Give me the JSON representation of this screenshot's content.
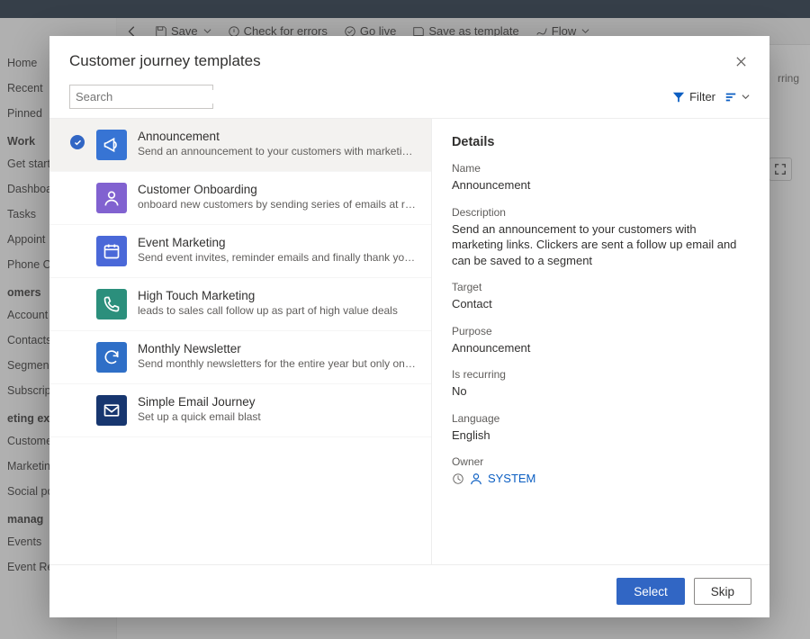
{
  "bg": {
    "toolbar": {
      "save": "Save",
      "check": "Check for errors",
      "golive": "Go live",
      "saveas": "Save as template",
      "flow": "Flow"
    },
    "leftnav": {
      "home": "Home",
      "recent": "Recent",
      "pinned": "Pinned",
      "section_work": "Work",
      "getstart": "Get start",
      "dashboard": "Dashboa",
      "tasks": "Tasks",
      "appoint": "Appoint",
      "phonec": "Phone C",
      "section_customers": "omers",
      "account": "Account",
      "contacts": "Contacts",
      "segments": "Segmen",
      "subscri": "Subscrip",
      "section_mktexec": "eting ex",
      "custjour": "Custome",
      "mktemail": "Marketin",
      "socialpo": "Social po",
      "section_eventmgmt": " manag",
      "events": "Events",
      "eventreg": "Event Registrations"
    },
    "summary_label": "rring"
  },
  "modal": {
    "title": "Customer journey templates",
    "search_placeholder": "Search",
    "filter_label": "Filter",
    "details_heading": "Details",
    "select_btn": "Select",
    "skip_btn": "Skip"
  },
  "templates": [
    {
      "title": "Announcement",
      "desc": "Send an announcement to your customers with marketing links. Clickers are sent a...",
      "tile_color": "#3774d4",
      "icon": "megaphone",
      "selected": true
    },
    {
      "title": "Customer Onboarding",
      "desc": "onboard new customers by sending series of emails at regular cadence",
      "tile_color": "#8162d0",
      "icon": "person",
      "selected": false
    },
    {
      "title": "Event Marketing",
      "desc": "Send event invites, reminder emails and finally thank you on attending",
      "tile_color": "#4a68d8",
      "icon": "calendar",
      "selected": false
    },
    {
      "title": "High Touch Marketing",
      "desc": "leads to sales call follow up as part of high value deals",
      "tile_color": "#2b8f7c",
      "icon": "phone",
      "selected": false
    },
    {
      "title": "Monthly Newsletter",
      "desc": "Send monthly newsletters for the entire year but only on weekday afternoons",
      "tile_color": "#2f6fc7",
      "icon": "refresh",
      "selected": false
    },
    {
      "title": "Simple Email Journey",
      "desc": "Set up a quick email blast",
      "tile_color": "#17366f",
      "icon": "mail",
      "selected": false
    }
  ],
  "details": {
    "name_label": "Name",
    "name_value": "Announcement",
    "description_label": "Description",
    "description_value": "Send an announcement to your customers with marketing links. Clickers are sent a follow up email and can be saved to a segment",
    "target_label": "Target",
    "target_value": "Contact",
    "purpose_label": "Purpose",
    "purpose_value": "Announcement",
    "recurring_label": "Is recurring",
    "recurring_value": "No",
    "language_label": "Language",
    "language_value": "English",
    "owner_label": "Owner",
    "owner_value": "SYSTEM"
  }
}
